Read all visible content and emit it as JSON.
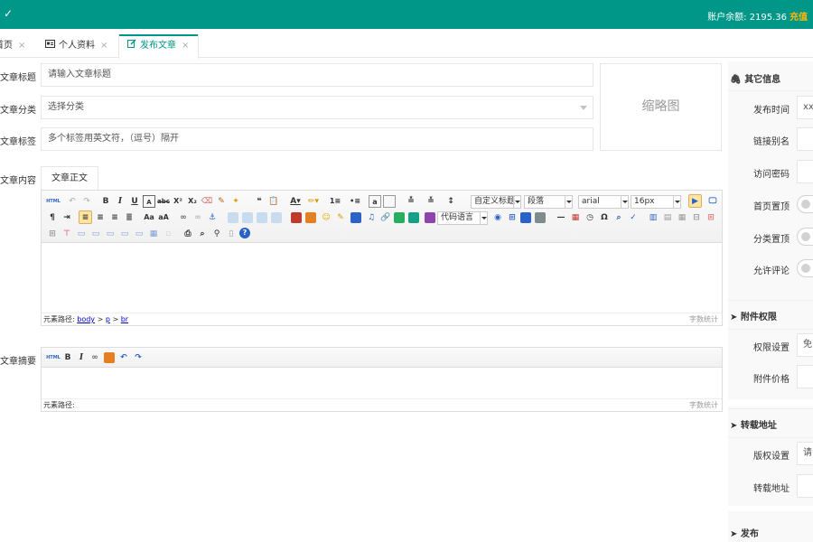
{
  "header": {
    "check_glyph": "✓",
    "balance_label": "账户余额: 2195.36",
    "recharge_label": "充值"
  },
  "tabs": [
    {
      "label": "首页",
      "close": "×"
    },
    {
      "label": "个人资料",
      "close": "×"
    },
    {
      "label": "发布文章",
      "close": "×"
    }
  ],
  "form": {
    "title_label": "文章标题",
    "title_placeholder": "请输入文章标题",
    "category_label": "文章分类",
    "category_value": "选择分类",
    "tags_label": "文章标签",
    "tags_placeholder": "多个标签用英文符，（逗号）隔开",
    "thumbnail_label": "缩略图",
    "content_label": "文章内容",
    "content_tab": "文章正文",
    "summary_label": "文章摘要"
  },
  "editor": {
    "html_btn": "HTML",
    "selects": {
      "heading": "自定义标题",
      "paragraph": "段落",
      "font": "arial",
      "size": "16px",
      "code": "代码语言"
    },
    "path_label": "元素路径:",
    "path_body": "body",
    "path_p": "p",
    "path_br": "br",
    "path_sep": ">",
    "word_count": "字数统计"
  },
  "editor2": {
    "path_label": "元素路径:",
    "word_count": "字数统计"
  },
  "sidebar": {
    "other_title": "其它信息",
    "publish_time_label": "发布时间",
    "publish_time_value": "xx",
    "alias_label": "链接别名",
    "password_label": "访问密码",
    "home_top_label": "首页置顶",
    "category_top_label": "分类置顶",
    "allow_comment_label": "允许评论",
    "attach_title": "附件权限",
    "permission_label": "权限设置",
    "permission_value": "免",
    "price_label": "附件价格",
    "repost_title": "转载地址",
    "copyright_label": "版权设置",
    "copyright_value": "请",
    "repost_label": "转载地址",
    "publish_title": "发布"
  },
  "colors": {
    "primary": "#009688",
    "recharge": "#ffb800"
  }
}
